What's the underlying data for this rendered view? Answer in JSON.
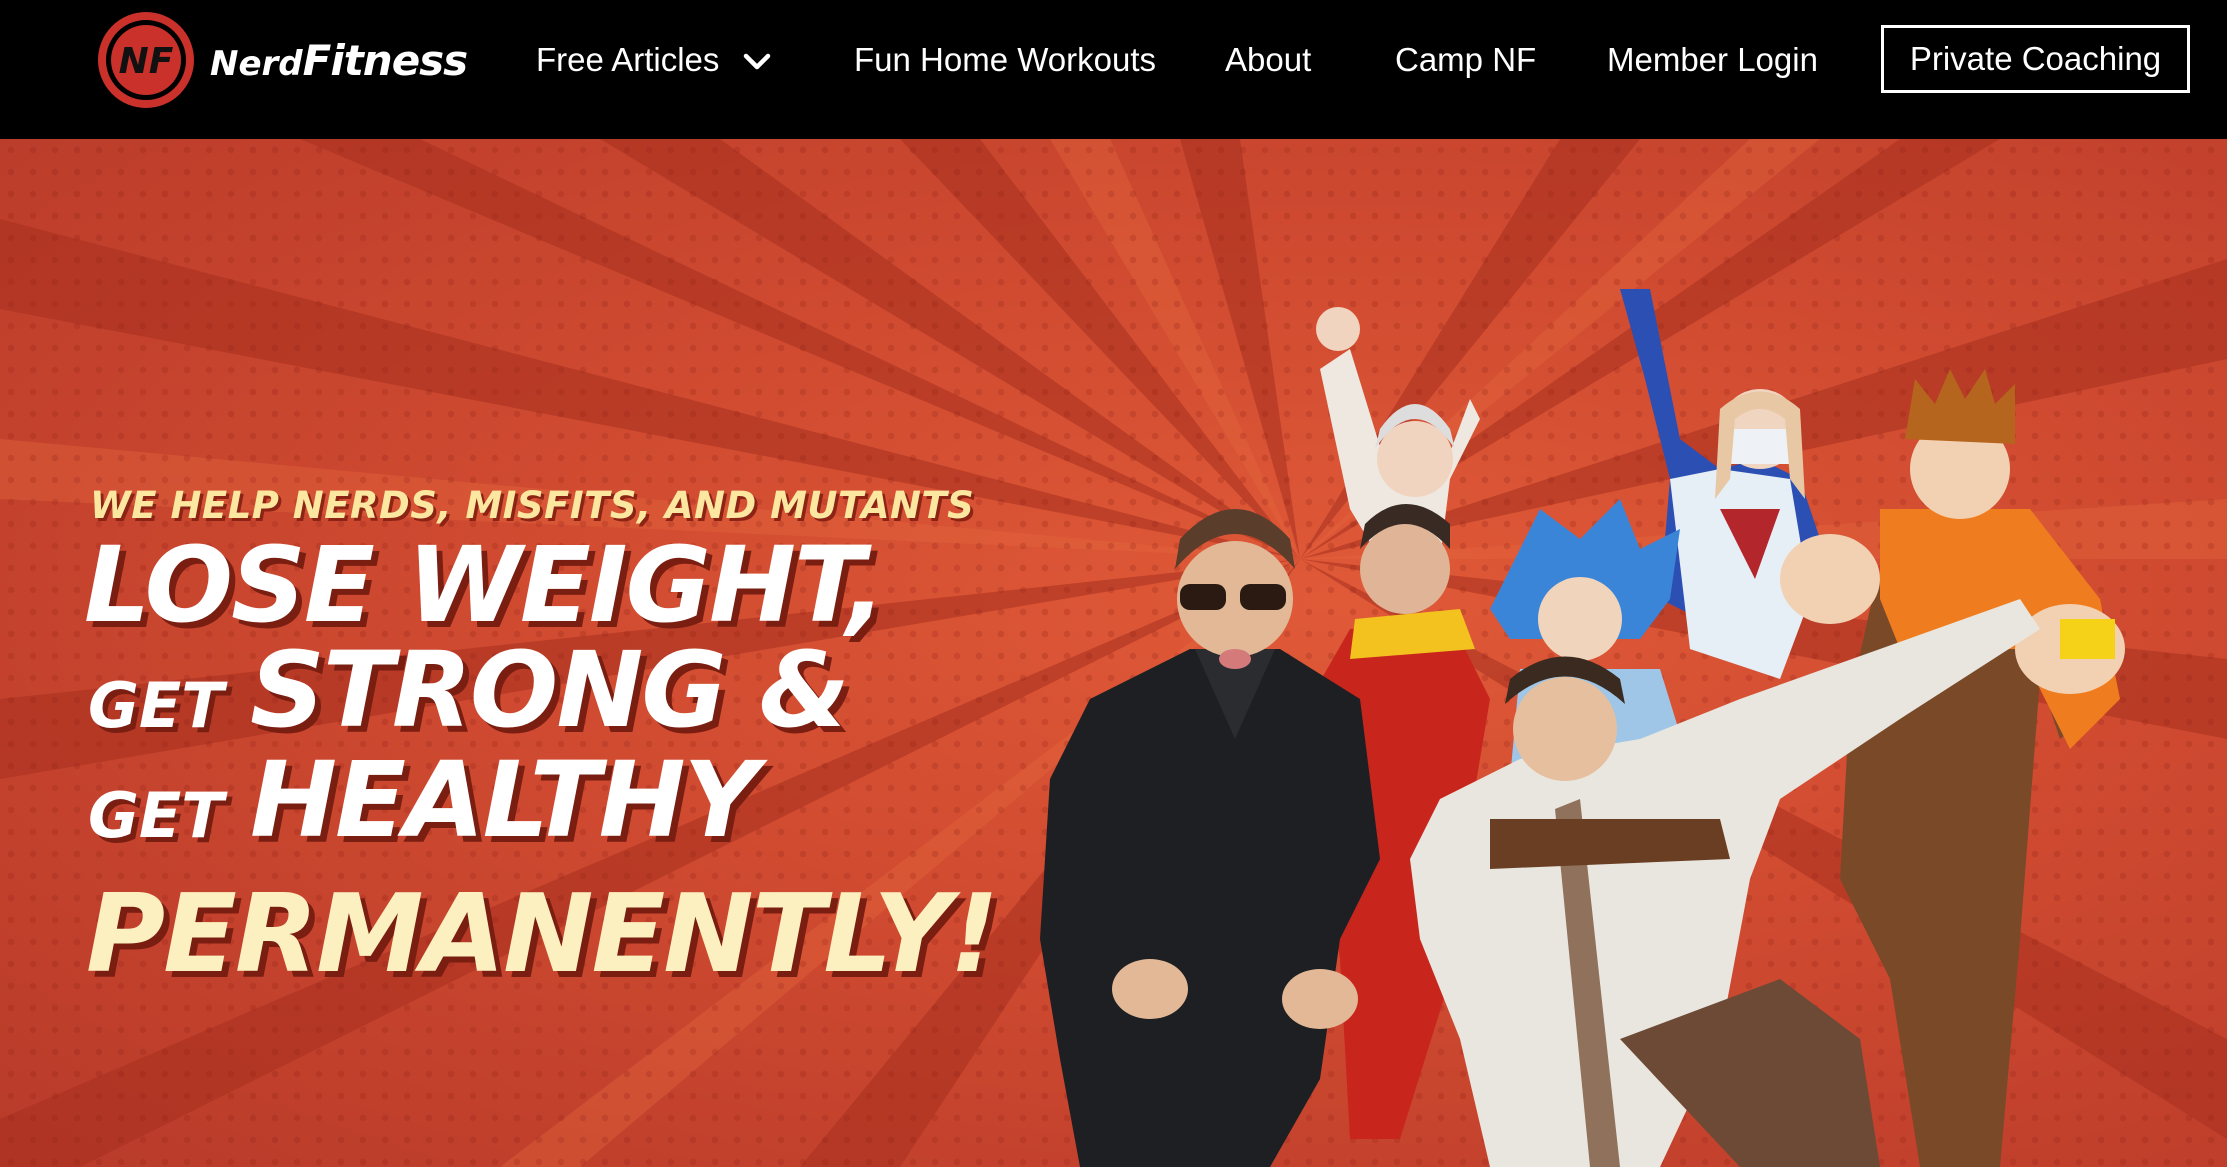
{
  "brand": {
    "logo_mark": "NF",
    "logo_text_1": "Nerd",
    "logo_text_2": "Fitness",
    "accent": "#c9432f",
    "nav_bg": "#000000"
  },
  "nav": {
    "items": [
      {
        "label": "Free Articles",
        "has_dropdown": true,
        "icon": "chevron-down-icon"
      },
      {
        "label": "Fun Home Workouts"
      },
      {
        "label": "About"
      },
      {
        "label": "Camp NF"
      },
      {
        "label": "Member Login"
      }
    ],
    "cta_label": "Private Coaching"
  },
  "hero": {
    "tagline": "WE HELP NERDS, MISFITS, AND MUTANTS",
    "line1": "LOSE WEIGHT,",
    "get1": "GET",
    "line2": "STRONG &",
    "get2": "GET",
    "line3": "HEALTHY",
    "line4": "PERMANENTLY!",
    "headline_color": "#ffffff",
    "tagline_color": "#fbe7a0",
    "emphasis_color": "#fcf0c0",
    "photo_description_icon": "costumed-group-photo"
  }
}
